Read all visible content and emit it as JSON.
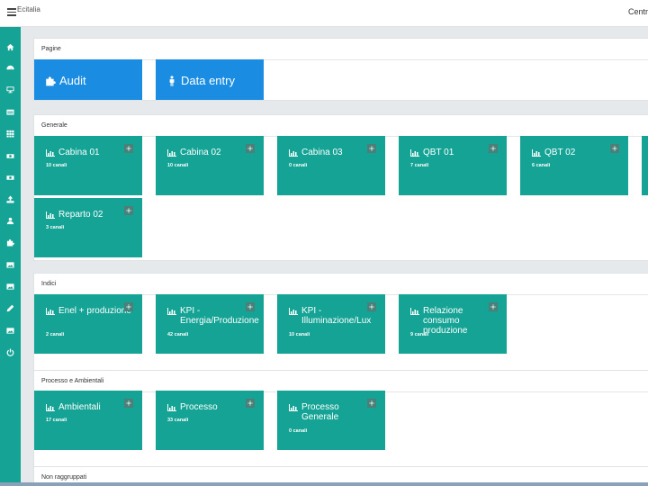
{
  "header": {
    "brand": "Ecitalia",
    "right_text": "Centr"
  },
  "sidebar": {
    "items": [
      {
        "icon": "home-icon"
      },
      {
        "icon": "dashboard-icon"
      },
      {
        "icon": "monitor-icon"
      },
      {
        "icon": "table-icon"
      },
      {
        "icon": "grid-icon"
      },
      {
        "icon": "money-icon"
      },
      {
        "icon": "money-icon"
      },
      {
        "icon": "upload-icon"
      },
      {
        "icon": "user-upload-icon"
      },
      {
        "icon": "puzzle-icon"
      },
      {
        "icon": "image-icon"
      },
      {
        "icon": "image-icon"
      },
      {
        "icon": "pencil-icon"
      },
      {
        "icon": "image-icon"
      },
      {
        "icon": "power-icon"
      }
    ]
  },
  "pagine": {
    "title": "Pagine",
    "tiles": [
      {
        "label": "Audit",
        "icon": "puzzle-icon",
        "color": "#1a8de2"
      },
      {
        "label": "Data entry",
        "icon": "person-icon",
        "color": "#1a8de2"
      }
    ]
  },
  "generale": {
    "title": "Generale",
    "tiles": [
      {
        "label": "Cabina 01",
        "count": "10 canali"
      },
      {
        "label": "Cabina 02",
        "count": "10 canali"
      },
      {
        "label": "Cabina 03",
        "count": "0 canali"
      },
      {
        "label": "QBT 01",
        "count": "7 canali"
      },
      {
        "label": "QBT 02",
        "count": "6 canali"
      },
      {
        "label": "Reparto 02",
        "count": "3 canali"
      }
    ]
  },
  "indici": {
    "title": "Indici",
    "tiles": [
      {
        "label": "Enel + produzione",
        "count": "2 canali"
      },
      {
        "label": "KPI - Energia/Produzione",
        "count": "42 canali"
      },
      {
        "label": "KPI - Illuminazione/Lux",
        "count": "10 canali"
      },
      {
        "label": "Relazione consumo produzione",
        "count": "9 canali"
      }
    ]
  },
  "processo": {
    "title": "Processo e Ambientali",
    "tiles": [
      {
        "label": "Ambientali",
        "count": "17 canali"
      },
      {
        "label": "Processo",
        "count": "33 canali"
      },
      {
        "label": "Processo Generale",
        "count": "0 canali"
      }
    ]
  },
  "non_raggruppati": {
    "title": "Non raggruppati"
  },
  "colors": {
    "accent_teal": "#14a394",
    "accent_blue": "#1a8de2"
  }
}
